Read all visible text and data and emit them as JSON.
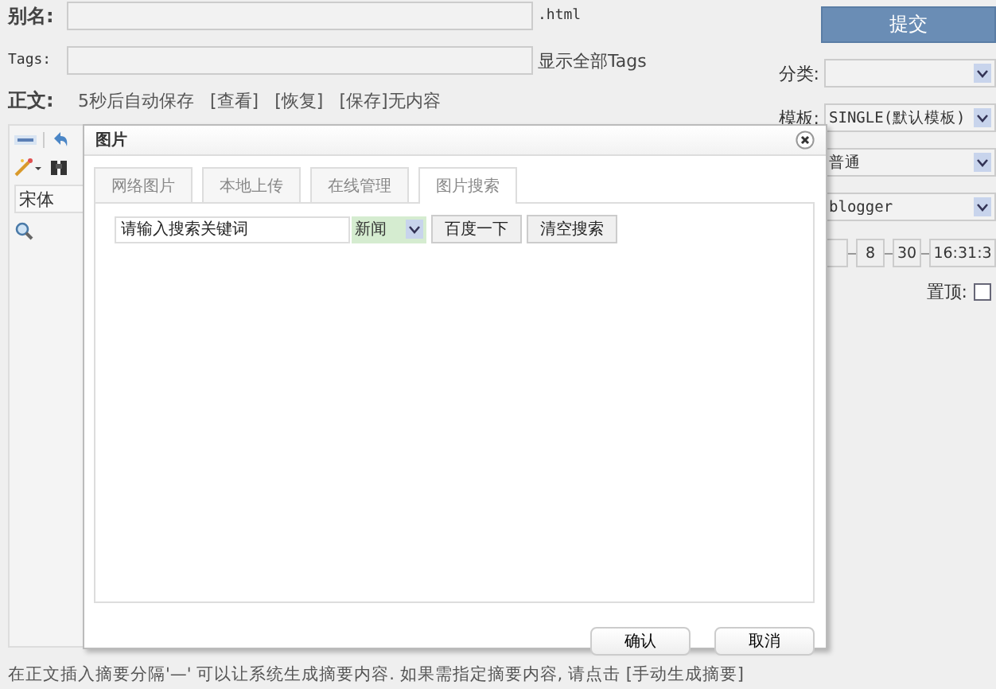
{
  "form": {
    "alias_label": "别名:",
    "alias_suffix": ".html",
    "tags_label": "Tags:",
    "show_all_tags": "显示全部Tags",
    "body_label": "正文:",
    "autosave": "5秒后自动保存",
    "links": [
      "[查看]",
      "[恢复]",
      "[保存]"
    ],
    "status": "无内容"
  },
  "editor_toolbar": {
    "font": "宋体"
  },
  "sidebar": {
    "submit": "提交",
    "selects": [
      {
        "label": "分类:"
      },
      {
        "label": "模板:",
        "value": "SINGLE(默认模板)"
      },
      {
        "value": "普通"
      },
      {
        "value": "blogger"
      }
    ],
    "date_parts": [
      "8",
      "30",
      "16:31:3"
    ],
    "pin": {
      "label": "置顶:",
      "checked": false
    }
  },
  "dialog": {
    "title": "图片",
    "tabs": [
      {
        "label": "网络图片",
        "selected": false
      },
      {
        "label": "本地上传",
        "selected": false
      },
      {
        "label": "在线管理",
        "selected": false
      },
      {
        "label": "图片搜索",
        "selected": true
      }
    ],
    "search": {
      "value": "请输入搜索关键词",
      "source": "新闻",
      "buttons": [
        "百度一下",
        "清空搜索"
      ]
    },
    "buttons": [
      "确认",
      "取消"
    ]
  },
  "hint": {
    "text": "在正文插入摘要分隔'—' 可以让系统生成摘要内容. 如果需指定摘要内容, 请点击",
    "link": "[手动生成摘要]"
  }
}
